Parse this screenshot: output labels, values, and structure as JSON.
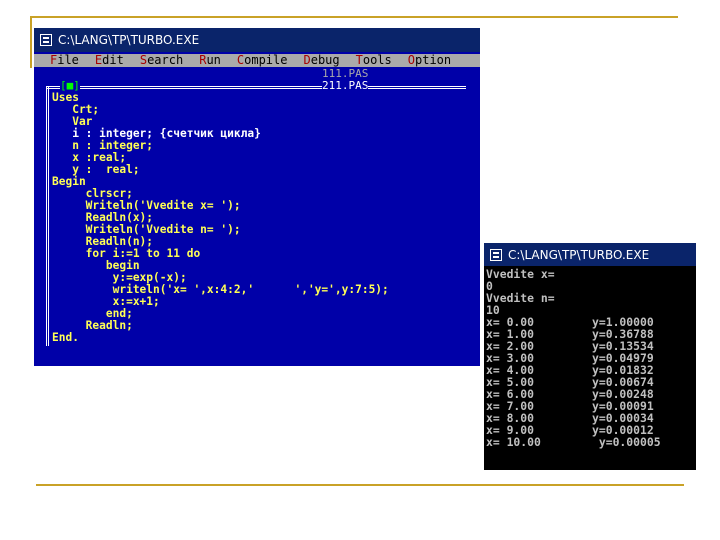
{
  "editor": {
    "title": "C:\\LANG\\TP\\TURBO.EXE",
    "menu": [
      {
        "hotkey": "F",
        "rest": "ile"
      },
      {
        "hotkey": "E",
        "rest": "dit"
      },
      {
        "hotkey": "S",
        "rest": "earch"
      },
      {
        "hotkey": "R",
        "rest": "un"
      },
      {
        "hotkey": "C",
        "rest": "ompile"
      },
      {
        "hotkey": "D",
        "rest": "ebug"
      },
      {
        "hotkey": "T",
        "rest": "ools"
      },
      {
        "hotkey": "O",
        "rest": "ption"
      }
    ],
    "tabs": [
      "111.PAS",
      "211.PAS"
    ],
    "window_marker": "[■]",
    "code_lines": [
      "Uses",
      "   Crt;",
      "   Var",
      "   i : integer; {счетчик цикла}",
      "   n : integer;",
      "   x :real;",
      "   y :  real;",
      "Begin",
      "     clrscr;",
      "     Writeln('Vvedite x= ');",
      "     Readln(x);",
      "     Writeln('Vvedite n= ');",
      "     Readln(n);",
      "     for i:=1 to 11 do",
      "        begin",
      "         y:=exp(-x);",
      "         writeln('x= ',x:4:2,'      ','y=',y:7:5);",
      "         x:=x+1;",
      "        end;",
      "     Readln;",
      "End."
    ]
  },
  "console": {
    "title": "C:\\LANG\\TP\\TURBO.EXE",
    "prompts": [
      "Vvedite x=",
      "0",
      "Vvedite n=",
      "10"
    ],
    "rows": [
      {
        "x": "x= 0.00",
        "y": "y=1.00000"
      },
      {
        "x": "x= 1.00",
        "y": "y=0.36788"
      },
      {
        "x": "x= 2.00",
        "y": "y=0.13534"
      },
      {
        "x": "x= 3.00",
        "y": "y=0.04979"
      },
      {
        "x": "x= 4.00",
        "y": "y=0.01832"
      },
      {
        "x": "x= 5.00",
        "y": "y=0.00674"
      },
      {
        "x": "x= 6.00",
        "y": "y=0.00248"
      },
      {
        "x": "x= 7.00",
        "y": "y=0.00091"
      },
      {
        "x": "x= 8.00",
        "y": "y=0.00034"
      },
      {
        "x": "x= 9.00",
        "y": "y=0.00012"
      },
      {
        "x": "x= 10.00",
        "y": " y=0.00005"
      }
    ]
  }
}
